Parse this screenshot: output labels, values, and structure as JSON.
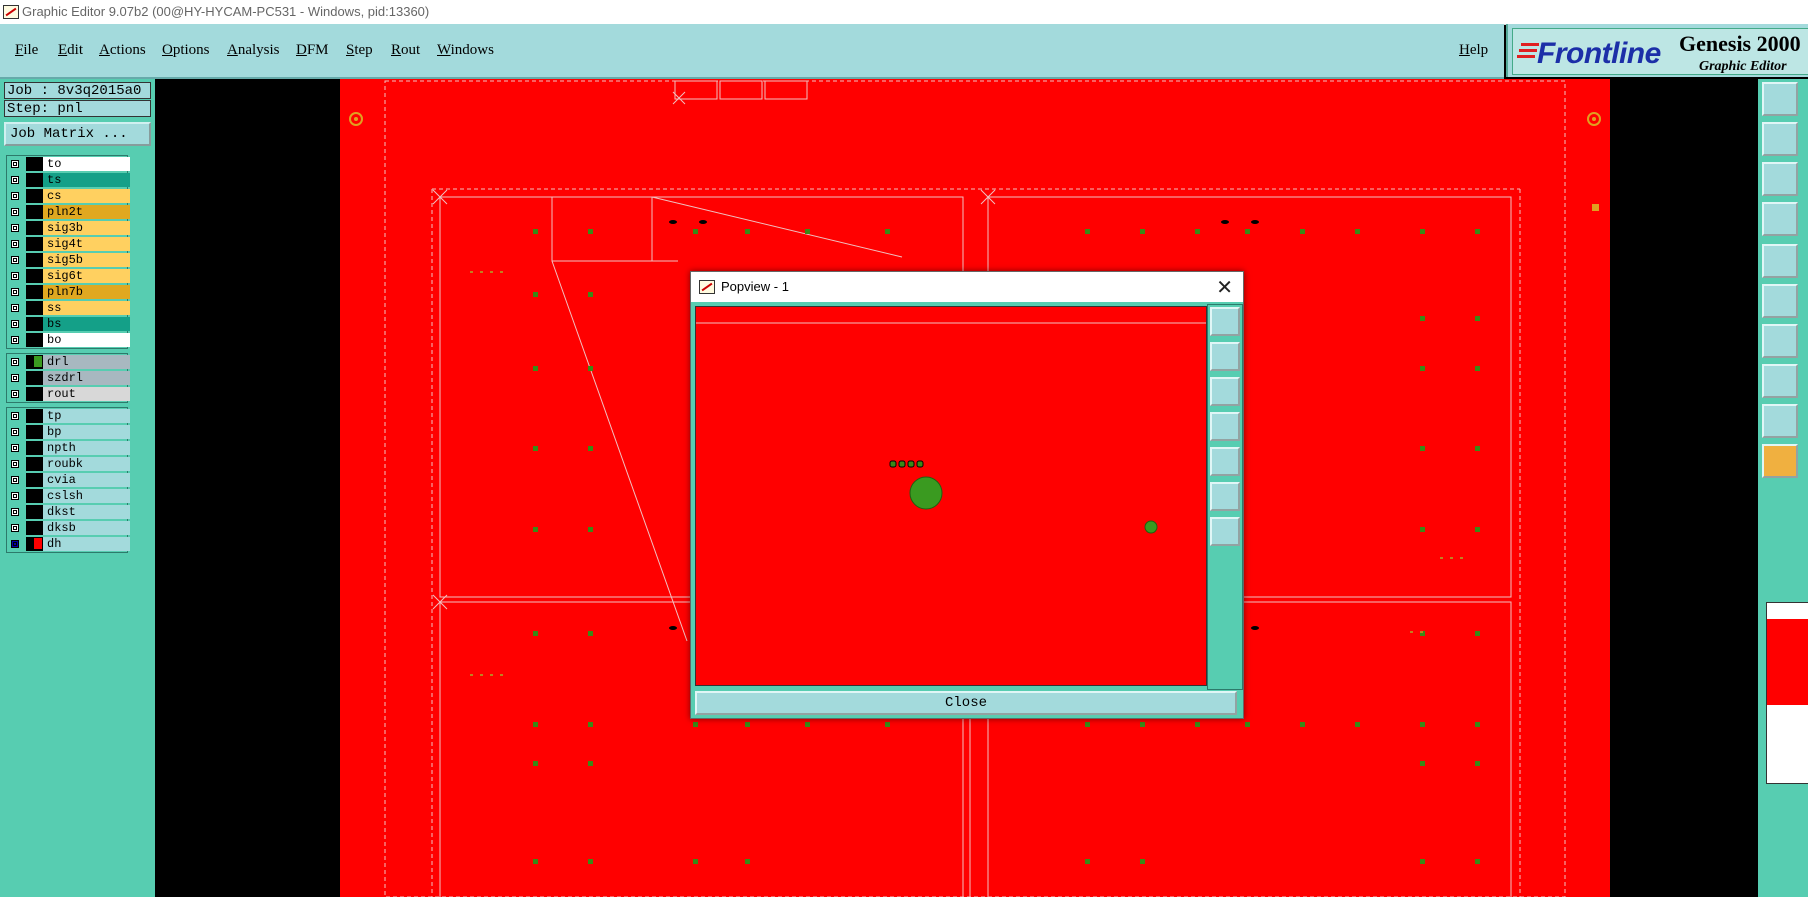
{
  "window": {
    "title": "Graphic Editor 9.07b2 (00@HY-HYCAM-PC531 - Windows, pid:13360)"
  },
  "menu": {
    "items": [
      "File",
      "Edit",
      "Actions",
      "Options",
      "Analysis",
      "DFM",
      "Step",
      "Rout",
      "Windows"
    ],
    "help": "Help"
  },
  "brand": {
    "logo": "Frontline",
    "product": "Genesis 2000",
    "subtitle": "Graphic Editor"
  },
  "job": {
    "job_label": "Job : 8v3q2015a0",
    "step_label": "Step: pnl",
    "matrix_button": "Job Matrix ..."
  },
  "layers": {
    "board": [
      {
        "name": "to",
        "bg": "#ffffff"
      },
      {
        "name": "ts",
        "bg": "#14a088"
      },
      {
        "name": "cs",
        "bg": "#ffd060"
      },
      {
        "name": "pln2t",
        "bg": "#e0a820"
      },
      {
        "name": "sig3b",
        "bg": "#ffd060"
      },
      {
        "name": "sig4t",
        "bg": "#ffd060"
      },
      {
        "name": "sig5b",
        "bg": "#ffd060"
      },
      {
        "name": "sig6t",
        "bg": "#ffd060"
      },
      {
        "name": "pln7b",
        "bg": "#e0a820"
      },
      {
        "name": "ss",
        "bg": "#ffd060"
      },
      {
        "name": "bs",
        "bg": "#14a088"
      },
      {
        "name": "bo",
        "bg": "#ffffff"
      }
    ],
    "drill": [
      {
        "name": "drl",
        "bg": "#a8b8c0",
        "swatch": "#3a9a20"
      },
      {
        "name": "szdrl",
        "bg": "#a8b8c0"
      },
      {
        "name": "rout",
        "bg": "#d8d8d8"
      }
    ],
    "misc": [
      {
        "name": "tp",
        "bg": "#a3dadc"
      },
      {
        "name": "bp",
        "bg": "#a3dadc"
      },
      {
        "name": "npth",
        "bg": "#a3dadc"
      },
      {
        "name": "roubk",
        "bg": "#a3dadc"
      },
      {
        "name": "cvia",
        "bg": "#a3dadc"
      },
      {
        "name": "cslsh",
        "bg": "#a3dadc"
      },
      {
        "name": "dkst",
        "bg": "#a3dadc"
      },
      {
        "name": "dksb",
        "bg": "#a3dadc"
      },
      {
        "name": "dh",
        "bg": "#a3dadc",
        "swatch": "#ff0000",
        "checked": true
      }
    ]
  },
  "popview": {
    "title": "Popview - 1",
    "close_button": "Close"
  },
  "colors": {
    "panel": "#57cdb1",
    "menu": "#a3dadc",
    "copper": "#ff0000",
    "pad": "#3a9a20"
  }
}
